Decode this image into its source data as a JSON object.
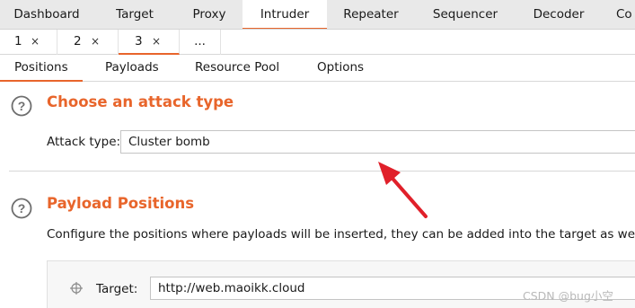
{
  "main_tabs": [
    "Dashboard",
    "Target",
    "Proxy",
    "Intruder",
    "Repeater",
    "Sequencer",
    "Decoder",
    "Co"
  ],
  "sub_tabs": {
    "items": [
      "1",
      "2",
      "3"
    ],
    "close_glyph": "×",
    "more": "..."
  },
  "section_tabs": [
    "Positions",
    "Payloads",
    "Resource Pool",
    "Options"
  ],
  "attack": {
    "title": "Choose an attack type",
    "label": "Attack type:",
    "value": "Cluster bomb"
  },
  "positions": {
    "title": "Payload Positions",
    "description": "Configure the positions where payloads will be inserted, they can be added into the target as well",
    "target_label": "Target:",
    "target_value": "http://web.maoikk.cloud"
  },
  "watermark": "CSDN @bug小空",
  "colors": {
    "accent": "#e8652b",
    "arrow": "#e0202a"
  },
  "icons": {
    "help": "question-circle-icon",
    "target": "crosshair-icon",
    "annotation": "red-arrow"
  }
}
